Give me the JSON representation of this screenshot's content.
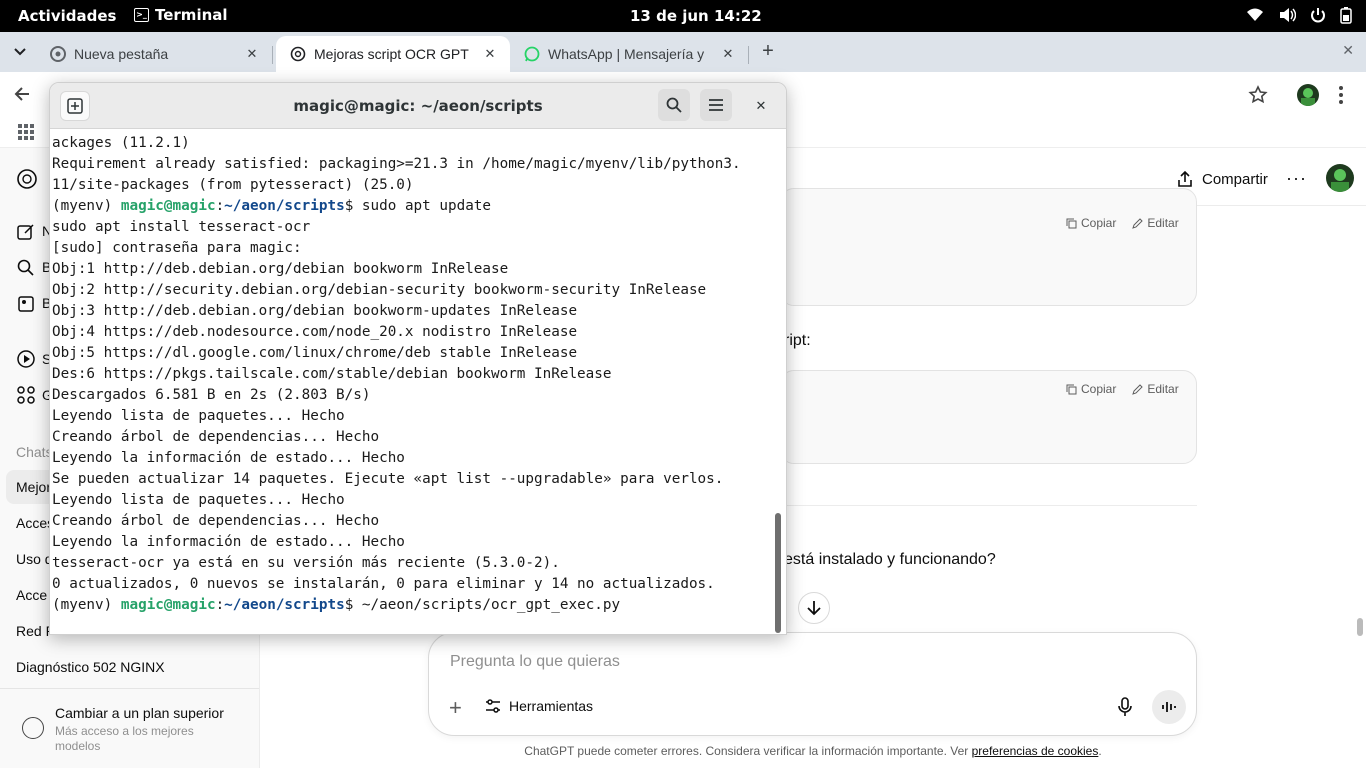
{
  "topbar": {
    "activities": "Actividades",
    "app_name": "Terminal",
    "clock": "13 de jun  14:22"
  },
  "tabs": [
    {
      "label": "Nueva pestaña",
      "active": false
    },
    {
      "label": "Mejoras script OCR GPT",
      "active": true
    },
    {
      "label": "WhatsApp | Mensajería y",
      "active": false
    }
  ],
  "sidebar": {
    "items_partial": [
      "N",
      "B",
      "B",
      "S",
      "G"
    ],
    "chats_heading": "Chats",
    "chats": [
      {
        "label": "Mejor",
        "active": true
      },
      {
        "label": "Acces",
        "active": false
      },
      {
        "label": "Uso d",
        "active": false
      },
      {
        "label": "Acce",
        "active": false
      },
      {
        "label": "Red P",
        "active": false
      },
      {
        "label": "Diagnóstico 502 NGINX",
        "active": false
      }
    ],
    "upgrade_title": "Cambiar a un plan superior",
    "upgrade_sub": "Más acceso a los mejores modelos"
  },
  "main": {
    "share_label": "Compartir",
    "more_label": "···",
    "copy_label": "Copiar",
    "edit_label": "Editar",
    "partial_text_1": "ript:",
    "partial_text_2": "está instalado y funcionando?",
    "composer_placeholder": "Pregunta lo que quieras",
    "tools_label": "Herramientas",
    "disclaimer": "ChatGPT puede cometer errores. Considera verificar la información importante. Ver ",
    "disclaimer_link": "preferencias de cookies",
    "disclaimer_end": "."
  },
  "terminal": {
    "title": "magic@magic: ~/aeon/scripts",
    "lines": [
      {
        "type": "text",
        "text": "ackages (11.2.1)"
      },
      {
        "type": "text",
        "text": "Requirement already satisfied: packaging>=21.3 in /home/magic/myenv/lib/python3."
      },
      {
        "type": "text",
        "text": "11/site-packages (from pytesseract) (25.0)"
      },
      {
        "type": "prompt",
        "env": "(myenv) ",
        "user": "magic@magic",
        "sep": ":",
        "path": "~/aeon/scripts",
        "cmd": "$ sudo apt update"
      },
      {
        "type": "text",
        "text": "sudo apt install tesseract-ocr"
      },
      {
        "type": "text",
        "text": "[sudo] contraseña para magic:"
      },
      {
        "type": "text",
        "text": "Obj:1 http://deb.debian.org/debian bookworm InRelease"
      },
      {
        "type": "text",
        "text": "Obj:2 http://security.debian.org/debian-security bookworm-security InRelease"
      },
      {
        "type": "text",
        "text": "Obj:3 http://deb.debian.org/debian bookworm-updates InRelease"
      },
      {
        "type": "text",
        "text": "Obj:4 https://deb.nodesource.com/node_20.x nodistro InRelease"
      },
      {
        "type": "text",
        "text": "Obj:5 https://dl.google.com/linux/chrome/deb stable InRelease"
      },
      {
        "type": "text",
        "text": "Des:6 https://pkgs.tailscale.com/stable/debian bookworm InRelease"
      },
      {
        "type": "text",
        "text": "Descargados 6.581 B en 2s (2.803 B/s)"
      },
      {
        "type": "text",
        "text": "Leyendo lista de paquetes... Hecho"
      },
      {
        "type": "text",
        "text": "Creando árbol de dependencias... Hecho"
      },
      {
        "type": "text",
        "text": "Leyendo la información de estado... Hecho"
      },
      {
        "type": "text",
        "text": "Se pueden actualizar 14 paquetes. Ejecute «apt list --upgradable» para verlos."
      },
      {
        "type": "text",
        "text": "Leyendo lista de paquetes... Hecho"
      },
      {
        "type": "text",
        "text": "Creando árbol de dependencias... Hecho"
      },
      {
        "type": "text",
        "text": "Leyendo la información de estado... Hecho"
      },
      {
        "type": "text",
        "text": "tesseract-ocr ya está en su versión más reciente (5.3.0-2)."
      },
      {
        "type": "text",
        "text": "0 actualizados, 0 nuevos se instalarán, 0 para eliminar y 14 no actualizados."
      },
      {
        "type": "prompt",
        "env": "(myenv) ",
        "user": "magic@magic",
        "sep": ":",
        "path": "~/aeon/scripts",
        "cmd": "$ ~/aeon/scripts/ocr_gpt_exec.py"
      }
    ]
  },
  "colors": {
    "prompt_user": "#26a269",
    "prompt_path": "#12488b",
    "topbar_bg": "#000000",
    "tabstrip_bg": "#dde3ea"
  }
}
